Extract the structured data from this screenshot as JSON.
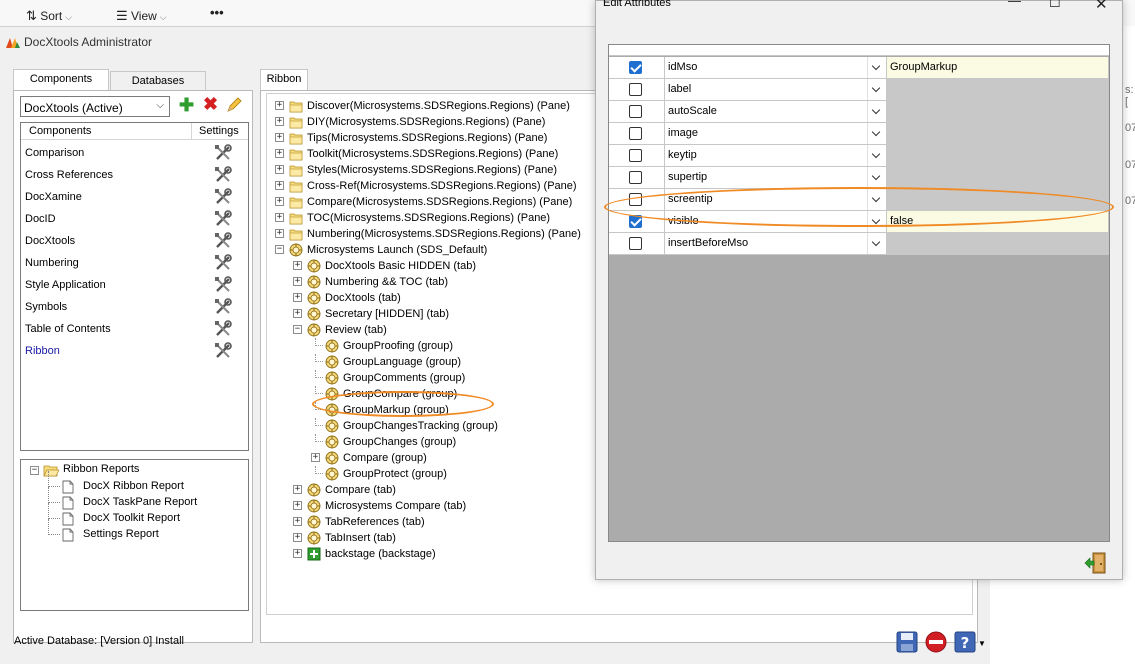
{
  "toolbar": {
    "sort_label": "Sort",
    "view_label": "View",
    "more_label": "•••"
  },
  "app": {
    "title": "DocXtools Administrator"
  },
  "left_tabs": [
    {
      "label": "Components"
    },
    {
      "label": "Databases"
    }
  ],
  "component_select": {
    "value": "DocXtools (Active)"
  },
  "components": {
    "header_name": "Components",
    "header_settings": "Settings",
    "items": [
      {
        "label": "Comparison"
      },
      {
        "label": "Cross References"
      },
      {
        "label": "DocXamine"
      },
      {
        "label": "DocID"
      },
      {
        "label": "DocXtools"
      },
      {
        "label": "Numbering"
      },
      {
        "label": "Style Application"
      },
      {
        "label": "Symbols"
      },
      {
        "label": "Table of Contents"
      },
      {
        "label": "Ribbon"
      }
    ],
    "selected_color": "#1a1aa6"
  },
  "reports": {
    "root": "Ribbon Reports",
    "items": [
      {
        "label": "DocX Ribbon Report"
      },
      {
        "label": "DocX TaskPane Report"
      },
      {
        "label": "DocX Toolkit Report"
      },
      {
        "label": "Settings Report"
      }
    ]
  },
  "ribbon_tab": {
    "label": "Ribbon"
  },
  "tree": {
    "rows": [
      {
        "label": "Discover(Microsystems.SDSRegions.Regions) (Pane)"
      },
      {
        "label": "DIY(Microsystems.SDSRegions.Regions) (Pane)"
      },
      {
        "label": "Tips(Microsystems.SDSRegions.Regions) (Pane)"
      },
      {
        "label": "Toolkit(Microsystems.SDSRegions.Regions) (Pane)"
      },
      {
        "label": "Styles(Microsystems.SDSRegions.Regions) (Pane)"
      },
      {
        "label": "Cross-Ref(Microsystems.SDSRegions.Regions) (Pane)"
      },
      {
        "label": "Compare(Microsystems.SDSRegions.Regions) (Pane)"
      },
      {
        "label": "TOC(Microsystems.SDSRegions.Regions) (Pane)"
      },
      {
        "label": "Numbering(Microsystems.SDSRegions.Regions) (Pane)"
      },
      {
        "label": "Microsystems Launch (SDS_Default)"
      },
      {
        "label": "DocXtools Basic HIDDEN (tab)"
      },
      {
        "label": "Numbering && TOC (tab)"
      },
      {
        "label": "DocXtools (tab)"
      },
      {
        "label": "Secretary [HIDDEN] (tab)"
      },
      {
        "label": "Review (tab)"
      },
      {
        "label": "GroupProofing (group)"
      },
      {
        "label": "GroupLanguage (group)"
      },
      {
        "label": "GroupComments (group)"
      },
      {
        "label": "GroupCompare (group)"
      },
      {
        "label": "GroupMarkup (group)"
      },
      {
        "label": "GroupChangesTracking (group)"
      },
      {
        "label": "GroupChanges (group)"
      },
      {
        "label": "Compare (group)"
      },
      {
        "label": "GroupProtect (group)"
      },
      {
        "label": "Compare (tab)"
      },
      {
        "label": "Microsystems Compare (tab)"
      },
      {
        "label": "TabReferences (tab)"
      },
      {
        "label": "TabInsert (tab)"
      },
      {
        "label": "backstage (backstage)"
      }
    ]
  },
  "status": {
    "text": "Active Database: [Version 0] Install"
  },
  "dialog": {
    "title": "Edit Attributes",
    "rows": [
      {
        "checked": true,
        "attribute": "idMso",
        "value": "GroupMarkup",
        "editable": true
      },
      {
        "checked": false,
        "attribute": "label",
        "value": "",
        "editable": false
      },
      {
        "checked": false,
        "attribute": "autoScale",
        "value": "",
        "editable": false
      },
      {
        "checked": false,
        "attribute": "image",
        "value": "",
        "editable": false
      },
      {
        "checked": false,
        "attribute": "keytip",
        "value": "",
        "editable": false
      },
      {
        "checked": false,
        "attribute": "supertip",
        "value": "",
        "editable": false
      },
      {
        "checked": false,
        "attribute": "screentip",
        "value": "",
        "editable": false
      },
      {
        "checked": true,
        "attribute": "visible",
        "value": "false",
        "editable": true
      },
      {
        "checked": false,
        "attribute": "insertBeforeMso",
        "value": "",
        "editable": false
      }
    ]
  },
  "peek": {
    "text1": "s: [",
    "text2": "07",
    "text3": "07",
    "text4": "07"
  },
  "colors": {
    "highlight": "#f08a24",
    "value_cell": "#fbfbe4",
    "grid_bg": "#ababab",
    "check_on": "#1f6fd1"
  }
}
